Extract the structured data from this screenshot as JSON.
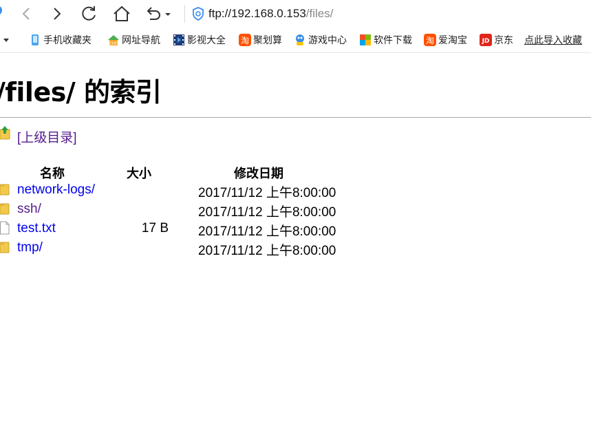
{
  "browser": {
    "url_host": "ftp://192.168.0.153",
    "url_path": "/files/"
  },
  "bookmarks": [
    {
      "label": "手机收藏夹",
      "icon": "phone-icon"
    },
    {
      "label": "网址导航",
      "icon": "house-2345-icon"
    },
    {
      "label": "影视大全",
      "icon": "film-icon"
    },
    {
      "label": "聚划算",
      "icon": "taobao-icon"
    },
    {
      "label": "游戏中心",
      "icon": "game-mascot-icon"
    },
    {
      "label": "软件下载",
      "icon": "windows-icon"
    },
    {
      "label": "爱淘宝",
      "icon": "taobao-icon"
    },
    {
      "label": "京东",
      "icon": "jd-icon"
    }
  ],
  "bookmarks_import_label": "点此导入收藏",
  "page": {
    "title": "/files/ 的索引",
    "parent_link": "[上级目录]",
    "columns": {
      "name": "名称",
      "size": "大小",
      "modified": "修改日期"
    },
    "files": [
      {
        "name": "network-logs/",
        "size": "",
        "modified": "2017/11/12 上午8:00:00",
        "type": "folder",
        "visited": false
      },
      {
        "name": "ssh/",
        "size": "",
        "modified": "2017/11/12 上午8:00:00",
        "type": "folder",
        "visited": true
      },
      {
        "name": "test.txt",
        "size": "17 B",
        "modified": "2017/11/12 上午8:00:00",
        "type": "file",
        "visited": false
      },
      {
        "name": "tmp/",
        "size": "",
        "modified": "2017/11/12 上午8:00:00",
        "type": "folder",
        "visited": false
      }
    ]
  },
  "colors": {
    "link": "#0000ee",
    "visited_link": "#551a8b",
    "folder": "#f2c94c"
  }
}
